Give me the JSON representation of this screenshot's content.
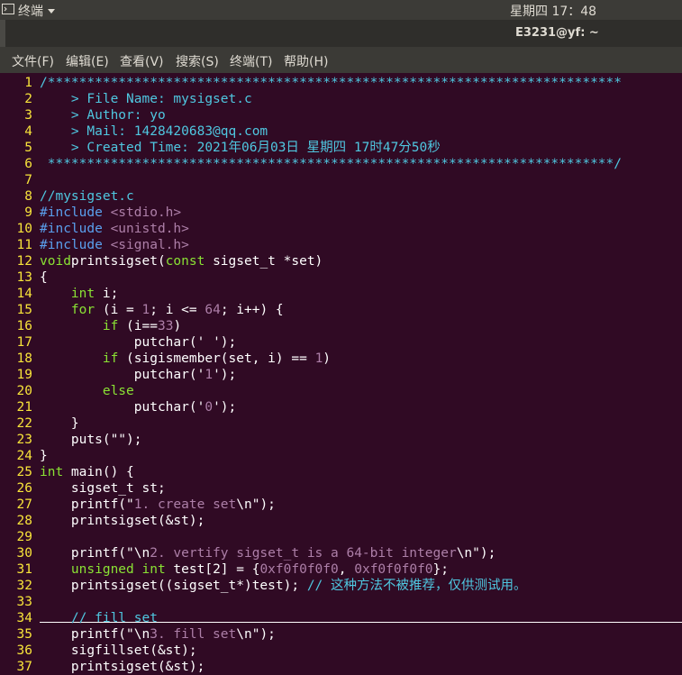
{
  "topbar": {
    "app_icon": "terminal-icon",
    "app_name": "终端",
    "dropdown_icon": "triangle-down-icon",
    "clock": "星期四 17：48"
  },
  "window": {
    "title": "E3231@yf: ~"
  },
  "menu": [
    "文件(F)",
    "编辑(E)",
    "查看(V)",
    "搜索(S)",
    "终端(T)",
    "帮助(H)"
  ],
  "colors": {
    "background": "#300a24",
    "line_numbers": "#f7e33a",
    "comment": "#4fc7e0",
    "keyword": "#8ae234",
    "preprocessor": "#5aa0ee",
    "string": "#ad7fa8"
  },
  "code": [
    {
      "n": "1",
      "t": [
        [
          "c",
          "/*************************************************************************"
        ]
      ]
    },
    {
      "n": "2",
      "t": [
        [
          "c",
          "    > File Name: mysigset.c"
        ]
      ]
    },
    {
      "n": "3",
      "t": [
        [
          "c",
          "    > Author: yo"
        ]
      ]
    },
    {
      "n": "4",
      "t": [
        [
          "c",
          "    > Mail: 1428420683@qq.com"
        ]
      ]
    },
    {
      "n": "5",
      "t": [
        [
          "c",
          "    > Created Time: 2021年06月03日 星期四 17时47分50秒"
        ]
      ]
    },
    {
      "n": "6",
      "t": [
        [
          "c",
          " ************************************************************************/"
        ]
      ]
    },
    {
      "n": "7",
      "t": []
    },
    {
      "n": "8",
      "t": [
        [
          "c",
          "//mysigset.c"
        ]
      ]
    },
    {
      "n": "9",
      "t": [
        [
          "p",
          "#include "
        ],
        [
          "s",
          "<stdio.h>"
        ]
      ]
    },
    {
      "n": "10",
      "t": [
        [
          "p",
          "#include "
        ],
        [
          "s",
          "<unistd.h>"
        ]
      ]
    },
    {
      "n": "11",
      "t": [
        [
          "p",
          "#include "
        ],
        [
          "s",
          "<signal.h>"
        ]
      ]
    },
    {
      "n": "12",
      "t": [
        [
          "k",
          "void"
        ],
        [
          "",
          "printsigset("
        ],
        [
          "k",
          "const"
        ],
        [
          "",
          " sigset_t *set)"
        ]
      ]
    },
    {
      "n": "13",
      "t": [
        [
          "",
          "{"
        ]
      ]
    },
    {
      "n": "14",
      "t": [
        [
          "",
          "    "
        ],
        [
          "k",
          "int"
        ],
        [
          "",
          " i;"
        ]
      ]
    },
    {
      "n": "15",
      "t": [
        [
          "",
          "    "
        ],
        [
          "k",
          "for"
        ],
        [
          "",
          " (i = "
        ],
        [
          "s",
          "1"
        ],
        [
          "",
          "; i <= "
        ],
        [
          "s",
          "64"
        ],
        [
          "",
          "; i++) {"
        ]
      ]
    },
    {
      "n": "16",
      "t": [
        [
          "",
          "        "
        ],
        [
          "k",
          "if"
        ],
        [
          "",
          " (i=="
        ],
        [
          "s",
          "33"
        ],
        [
          "",
          ")"
        ]
      ]
    },
    {
      "n": "17",
      "t": [
        [
          "",
          "            putchar('"
        ],
        [
          "s",
          " "
        ],
        [
          "",
          "');"
        ]
      ]
    },
    {
      "n": "18",
      "t": [
        [
          "",
          "        "
        ],
        [
          "k",
          "if"
        ],
        [
          "",
          " (sigismember(set, i) == "
        ],
        [
          "s",
          "1"
        ],
        [
          "",
          ")"
        ]
      ]
    },
    {
      "n": "19",
      "t": [
        [
          "",
          "            putchar('"
        ],
        [
          "s",
          "1"
        ],
        [
          "",
          "');"
        ]
      ]
    },
    {
      "n": "20",
      "t": [
        [
          "",
          "        "
        ],
        [
          "k",
          "else"
        ]
      ]
    },
    {
      "n": "21",
      "t": [
        [
          "",
          "            putchar('"
        ],
        [
          "s",
          "0"
        ],
        [
          "",
          "');"
        ]
      ]
    },
    {
      "n": "22",
      "t": [
        [
          "",
          "    }"
        ]
      ]
    },
    {
      "n": "23",
      "t": [
        [
          "",
          "    puts(\"\");"
        ]
      ]
    },
    {
      "n": "24",
      "t": [
        [
          "",
          "}"
        ]
      ]
    },
    {
      "n": "25",
      "t": [
        [
          "k",
          "int"
        ],
        [
          "",
          " main() {"
        ]
      ]
    },
    {
      "n": "26",
      "t": [
        [
          "",
          "    sigset_t st;"
        ]
      ]
    },
    {
      "n": "27",
      "t": [
        [
          "",
          "    printf(\""
        ],
        [
          "s",
          "1. create set"
        ],
        [
          "",
          "\\n\");"
        ]
      ]
    },
    {
      "n": "28",
      "t": [
        [
          "",
          "    printsigset(&st);"
        ]
      ]
    },
    {
      "n": "29",
      "t": []
    },
    {
      "n": "30",
      "t": [
        [
          "",
          "    printf(\"\\n"
        ],
        [
          "s",
          "2. vertify sigset_t is a 64-bit integer"
        ],
        [
          "",
          "\\n\");"
        ]
      ]
    },
    {
      "n": "31",
      "t": [
        [
          "",
          "    "
        ],
        [
          "k",
          "unsigned int"
        ],
        [
          "",
          " test[2] = {"
        ],
        [
          "s",
          "0xf0f0f0f0"
        ],
        [
          "",
          ", "
        ],
        [
          "s",
          "0xf0f0f0f0"
        ],
        [
          "",
          "};"
        ]
      ]
    },
    {
      "n": "32",
      "t": [
        [
          "",
          "    printsigset((sigset_t*)test); "
        ],
        [
          "c",
          "// 这种方法不被推荐，仅供测试用。"
        ]
      ]
    },
    {
      "n": "33",
      "t": []
    },
    {
      "n": "34",
      "t": [
        [
          "",
          "    "
        ],
        [
          "c",
          "// fill set"
        ]
      ]
    },
    {
      "n": "35",
      "t": [
        [
          "",
          "    printf(\"\\n"
        ],
        [
          "s",
          "3. fill set"
        ],
        [
          "",
          "\\n\");"
        ]
      ]
    },
    {
      "n": "36",
      "t": [
        [
          "",
          "    sigfillset(&st);"
        ]
      ]
    },
    {
      "n": "37",
      "t": [
        [
          "",
          "    printsigset(&st);"
        ]
      ]
    }
  ]
}
